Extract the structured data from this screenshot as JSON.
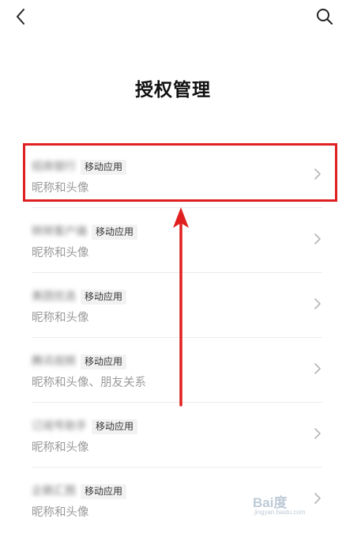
{
  "header": {
    "back_icon": "chevron-left-icon",
    "search_icon": "search-icon"
  },
  "page": {
    "title": "授权管理"
  },
  "items": [
    {
      "app_name": "招商银行",
      "tag": "移动应用",
      "permissions": "昵称和头像"
    },
    {
      "app_name": "转转客户端",
      "tag": "移动应用",
      "permissions": "昵称和头像"
    },
    {
      "app_name": "美团优选",
      "tag": "移动应用",
      "permissions": "昵称和头像"
    },
    {
      "app_name": "腾讯视频",
      "tag": "移动应用",
      "permissions": "昵称和头像、朋友关系"
    },
    {
      "app_name": "订阅号助手",
      "tag": "移动应用",
      "permissions": "昵称和头像"
    },
    {
      "app_name": "企鹅汇图",
      "tag": "移动应用",
      "permissions": "昵称和头像"
    }
  ],
  "annotation": {
    "color": "#e02020"
  },
  "watermark": {
    "logo": "Bai度",
    "url": "jingyan.baidu.com"
  }
}
